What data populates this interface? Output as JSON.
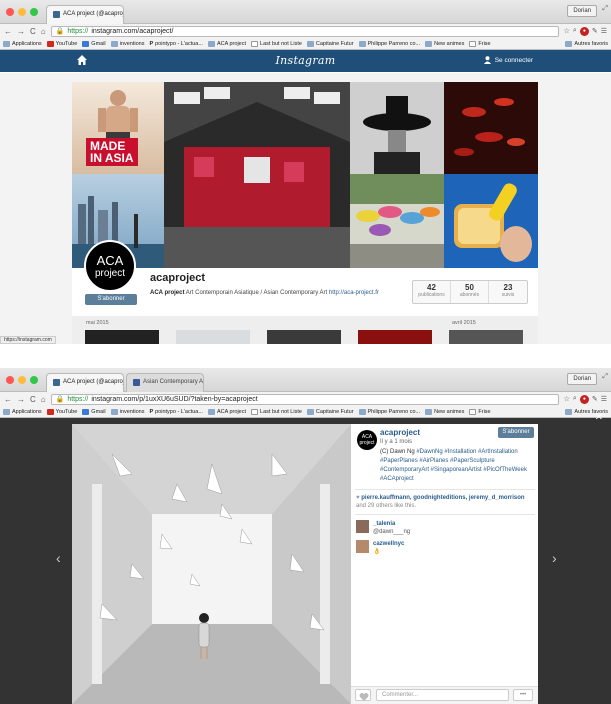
{
  "shot1": {
    "tab": {
      "title": "ACA project (@acaproject)",
      "close": "×"
    },
    "user_button": "Dorian",
    "url": {
      "scheme": "https://",
      "rest": "instagram.com/acaproject/"
    },
    "bookmarks": [
      "Applications",
      "YouTube",
      "Gmail",
      "inventions",
      "pointypo - L'actua...",
      "ACA project",
      "Last but not Liste",
      "Capitaine Futur",
      "Philippe Parreno co...",
      "New animes",
      "Frise"
    ],
    "bookmarks_right": "Autres favoris",
    "ig": {
      "logo": "Instagram",
      "connect": "Se connecter"
    },
    "cover_badge_line1": "MADE",
    "cover_badge_line2": "IN ASIA",
    "profile": {
      "avatar_line1": "ACA",
      "avatar_line2": "project",
      "follow": "S'abonner",
      "username": "acaproject",
      "bio_name": "ACA project",
      "bio_text": " Art Contemporain Asiatique / Asian Contemporary Art ",
      "bio_link": "http://aca-project.fr"
    },
    "stats": [
      {
        "n": "42",
        "label": "publications"
      },
      {
        "n": "50",
        "label": "abonnés"
      },
      {
        "n": "23",
        "label": "suivis"
      }
    ],
    "months": [
      "mai 2015",
      "avril 2015"
    ],
    "status_url": "https://instagram.com"
  },
  "shot2": {
    "tabs": [
      "ACA project (@acaproject)",
      "Asian Contemporary Art"
    ],
    "user_button": "Dorian",
    "url": {
      "scheme": "https://",
      "rest": "instagram.com/p/1uxXU6uSUD/?taken-by=acaproject"
    },
    "bookmarks": [
      "Applications",
      "YouTube",
      "Gmail",
      "inventions",
      "pointypo - L'actua...",
      "ACA project",
      "Last but not Liste",
      "Capitaine Futur",
      "Philippe Parreno co...",
      "New animes",
      "Frise"
    ],
    "bookmarks_right": "Autres favoris",
    "post": {
      "username": "acaproject",
      "time": "Il y a 1 mois",
      "follow": "S'abonner",
      "caption_plain": "(C) Dawn Ng ",
      "caption_tags": "#DawnNg #Installation #ArtInstallation #PaperPlanes #AirPlanes #PaperSculpture #ContemporaryArt #SingaporeanArtist #PicOfTheWeek #ACAproject",
      "likes_names": "pierre.kauffmann, goodnighteditions, jeremy_d_morrison",
      "likes_rest": "and 29 others like this.",
      "comments": [
        {
          "user": "_talenia",
          "text": "@dawn___ng"
        },
        {
          "user": "cazwellnyc",
          "text": "👌"
        }
      ],
      "comment_placeholder": "Commenter...",
      "more": "•••"
    }
  }
}
